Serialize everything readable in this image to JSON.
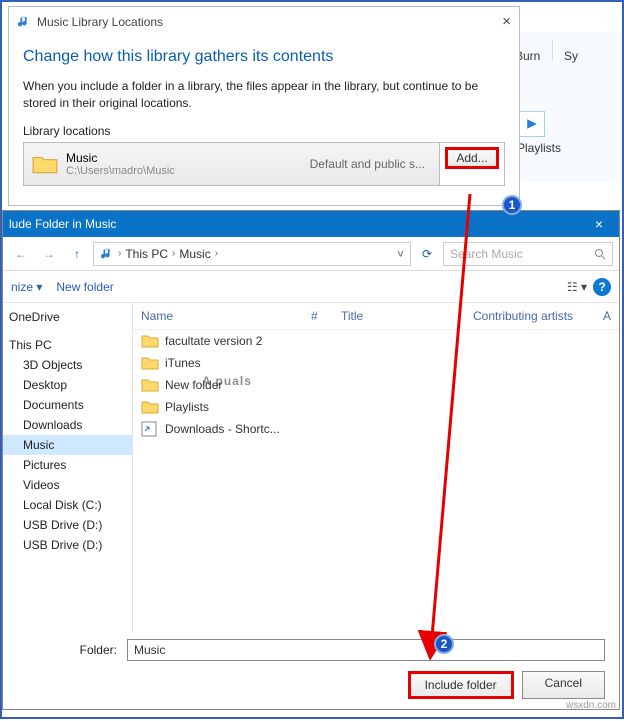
{
  "dlg1": {
    "title": "Music Library Locations",
    "heading": "Change how this library gathers its contents",
    "desc": "When you include a folder in a library, the files appear in the library, but continue to be stored in their original locations.",
    "locLabel": "Library locations",
    "item": {
      "name": "Music",
      "path": "C:\\Users\\madro\\Music",
      "status": "Default and public s..."
    },
    "add": "Add..."
  },
  "bg": {
    "burn": "Burn",
    "sync": "Sy",
    "playlists": "Playlists"
  },
  "dlg2": {
    "title": "lude Folder in Music",
    "crumbs": [
      "This PC",
      "Music"
    ],
    "searchPlaceholder": "Search Music",
    "organize": "nize",
    "newFolder": "New folder",
    "cols": {
      "name": "Name",
      "num": "#",
      "title": "Title",
      "artists": "Contributing artists",
      "album": "A"
    },
    "side": [
      "OneDrive",
      "This PC",
      "3D Objects",
      "Desktop",
      "Documents",
      "Downloads",
      "Music",
      "Pictures",
      "Videos",
      "Local Disk (C:)",
      "USB Drive (D:)",
      "USB Drive (D:)"
    ],
    "files": [
      {
        "name": "facultate version 2",
        "type": "folder"
      },
      {
        "name": "iTunes",
        "type": "folder"
      },
      {
        "name": "New folder",
        "type": "folder"
      },
      {
        "name": "Playlists",
        "type": "folder"
      },
      {
        "name": "Downloads - Shortc...",
        "type": "shortcut"
      }
    ],
    "folderLabel": "Folder:",
    "folderValue": "Music",
    "include": "Include folder",
    "cancel": "Cancel"
  },
  "watermark": "A  puals",
  "source": "wsxdn.com"
}
